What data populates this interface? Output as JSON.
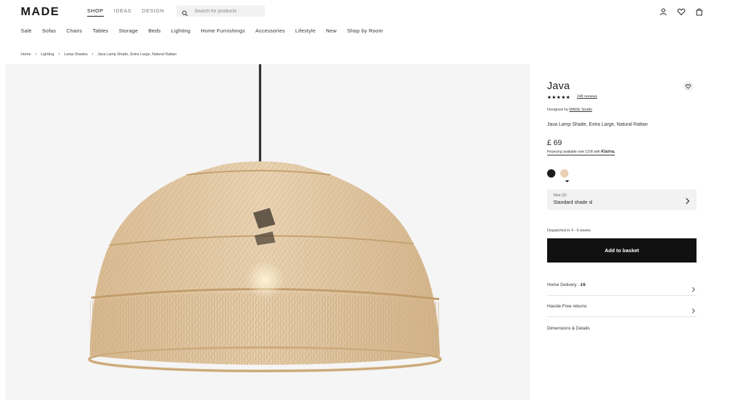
{
  "header": {
    "logo": "MADE",
    "tabs": [
      {
        "label": "SHOP"
      },
      {
        "label": "IDEAS"
      },
      {
        "label": "DESIGN"
      }
    ],
    "search_placeholder": "Search for products",
    "icons": [
      "account-icon",
      "heart-icon",
      "basket-icon"
    ]
  },
  "categories": [
    "Sale",
    "Sofas",
    "Chairs",
    "Tables",
    "Storage",
    "Beds",
    "Lighting",
    "Home Furnishings",
    "Accessories",
    "Lifestyle",
    "New",
    "Shop by Room"
  ],
  "breadcrumb": [
    "Home",
    "Lighting",
    "Lamp Shades",
    "Java Lamp Shade, Extra Large, Natural Rattan"
  ],
  "product": {
    "name": "Java",
    "rating": "★★★★★",
    "reviews": "248 reviews",
    "designed_prefix": "Designed by",
    "designer": "MADE Studio",
    "description": "Java Lamp Shade, Extra Large, Natural Rattan",
    "price": "£ 69",
    "finance_text": "Financing available over £100 with",
    "finance_brand": "Klarna.",
    "swatch_colors": [
      "#1c1c1c",
      "#e9cfb3"
    ],
    "size_label": "Size (2)",
    "size_value": "Standard shade sl",
    "dispatch": "Dispatched in 4 - 6 weeks",
    "add_button": "Add to basket",
    "delivery_label": "Home Delivery - ",
    "delivery_price": "£6",
    "returns_label": "Hassle-Free returns",
    "details_label": "Dimensions & Details"
  },
  "colors": {
    "accent": "#111111",
    "image_bg": "#f5f5f5",
    "rattan": "#dcc09a"
  }
}
